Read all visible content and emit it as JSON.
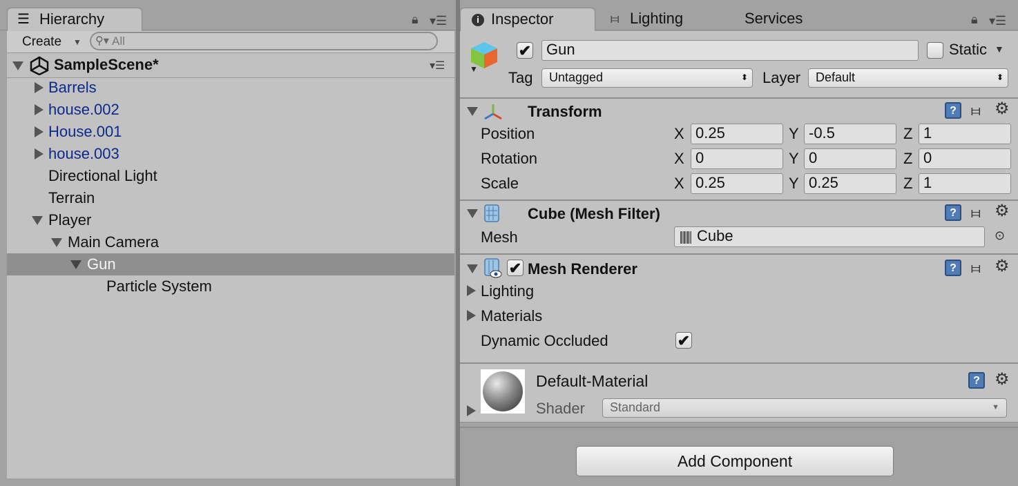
{
  "hierarchy": {
    "tab_label": "Hierarchy",
    "create_label": "Create",
    "search_placeholder": "All",
    "scene_name": "SampleScene*",
    "items": [
      {
        "label": "Barrels",
        "prefab": true
      },
      {
        "label": "house.002",
        "prefab": true
      },
      {
        "label": "House.001",
        "prefab": true
      },
      {
        "label": "house.003",
        "prefab": true
      },
      {
        "label": "Directional Light",
        "prefab": false
      },
      {
        "label": "Terrain",
        "prefab": false
      },
      {
        "label": "Player",
        "prefab": false
      },
      {
        "label": "Main Camera",
        "prefab": false
      },
      {
        "label": "Gun",
        "prefab": false
      },
      {
        "label": "Particle System",
        "prefab": false
      }
    ]
  },
  "inspector": {
    "tabs": {
      "inspector": "Inspector",
      "lighting": "Lighting",
      "services": "Services"
    },
    "object_name": "Gun",
    "static_label": "Static",
    "tag_label": "Tag",
    "tag_value": "Untagged",
    "layer_label": "Layer",
    "layer_value": "Default",
    "transform": {
      "title": "Transform",
      "position_label": "Position",
      "rotation_label": "Rotation",
      "scale_label": "Scale",
      "axis_x": "X",
      "axis_y": "Y",
      "axis_z": "Z",
      "position": {
        "x": "0.25",
        "y": "-0.5",
        "z": "1"
      },
      "rotation": {
        "x": "0",
        "y": "0",
        "z": "0"
      },
      "scale": {
        "x": "0.25",
        "y": "0.25",
        "z": "1"
      }
    },
    "mesh_filter": {
      "title": "Cube (Mesh Filter)",
      "mesh_label": "Mesh",
      "mesh_value": "Cube"
    },
    "mesh_renderer": {
      "title": "Mesh Renderer",
      "lighting_label": "Lighting",
      "materials_label": "Materials",
      "dynamic_occluded_label": "Dynamic Occluded"
    },
    "material": {
      "name": "Default-Material",
      "shader_label": "Shader",
      "shader_value": "Standard"
    },
    "add_component_label": "Add Component"
  },
  "colors": {
    "prefab_text": "#0d2a8a",
    "selection": "#8f8f8f",
    "panel": "#c2c2c2"
  }
}
